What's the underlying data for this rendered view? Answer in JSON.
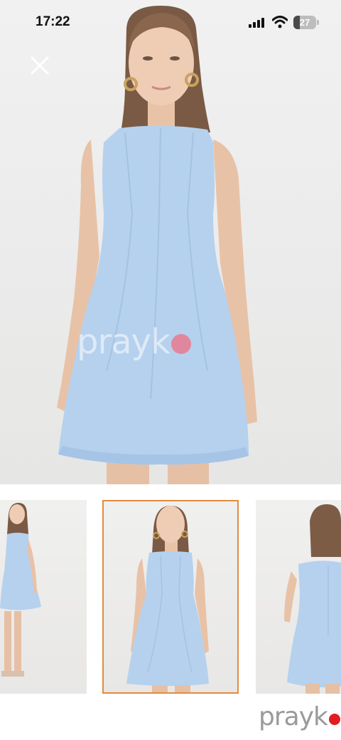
{
  "status_bar": {
    "time": "17:22",
    "battery_level": "27",
    "icons": [
      "signal-icon",
      "wifi-icon",
      "battery-icon"
    ]
  },
  "viewer": {
    "close_icon": "close-icon",
    "watermark": "prayk",
    "selected_thumbnail": 2,
    "thumbnails": [
      {
        "name": "thumbnail-1",
        "view": "full-length-front"
      },
      {
        "name": "thumbnail-2",
        "view": "front"
      },
      {
        "name": "thumbnail-3",
        "view": "back"
      }
    ]
  },
  "footer": {
    "brand": "prayk"
  },
  "colors": {
    "dress": "#b5d1ee",
    "selected_border": "#e38b3e",
    "brand_dot": "#e01d24",
    "watermark_dot": "#f06e82"
  }
}
